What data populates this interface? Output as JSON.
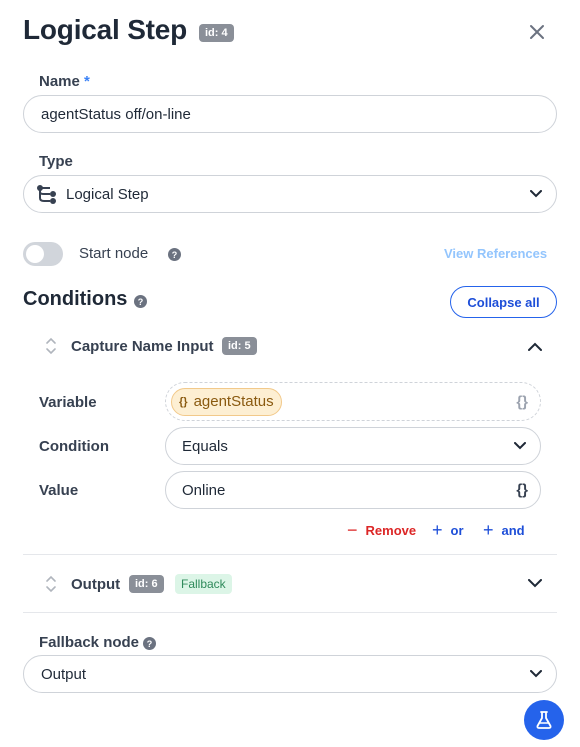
{
  "header": {
    "title": "Logical Step",
    "id_badge": "id: 4"
  },
  "name": {
    "label": "Name",
    "required": "*",
    "value": "agentStatus off/on-line"
  },
  "type": {
    "label": "Type",
    "value": "Logical Step"
  },
  "start_node": {
    "label": "Start node",
    "help": "?",
    "enabled": false
  },
  "view_references": "View References",
  "conditions": {
    "title": "Conditions",
    "help": "?",
    "collapse_all": "Collapse all",
    "blocks": [
      {
        "title": "Capture Name Input",
        "id_badge": "id: 5",
        "expanded": true,
        "variable_label": "Variable",
        "variable_value": "agentStatus",
        "variable_chip_icon": "{}",
        "variable_braces": "{}",
        "condition_label": "Condition",
        "condition_value": "Equals",
        "value_label": "Value",
        "value_value": "Online",
        "value_braces": "{}",
        "remove_label": "Remove",
        "or_label": "or",
        "and_label": "and"
      },
      {
        "title": "Output",
        "id_badge": "id: 6",
        "tag": "Fallback",
        "expanded": false
      }
    ]
  },
  "fallback_node": {
    "label": "Fallback node",
    "help": "?",
    "value": "Output"
  },
  "colors": {
    "accent": "#2563eb",
    "danger": "#dc2626",
    "chip_bg": "#fdefd3",
    "fallback_bg": "#dcf5e7"
  },
  "icons": {
    "close": "close-icon",
    "type": "flow-branch-icon",
    "fab": "flask-icon"
  }
}
